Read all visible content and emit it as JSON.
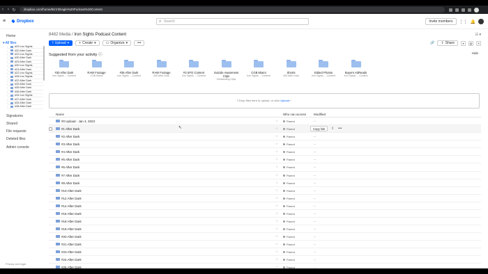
{
  "browser": {
    "url": "dropbox.com/home/Brrrrt/Eagle%20Podcast%20Content"
  },
  "app": {
    "brand": "Dropbox",
    "search_placeholder": "Search",
    "invite_label": "Invite members"
  },
  "sidebar": {
    "home": "Home",
    "all_files": "All files",
    "tree": [
      "#29 Iron Sights",
      "#32 After Dark",
      "#31 Iron Sights",
      "#30 After Dark",
      "#29 After Dark",
      "#30 Iron Sights",
      "#24 After Dark",
      "#22 Iron Sights",
      "#28 Iron Sights",
      "#22 After Dark",
      "#33 After Dark",
      "#35 After Dark",
      "#36 After Dark",
      "#34 Iron Sights",
      "#37 After Dark",
      "#34 After Dark",
      "#38 After Dark"
    ],
    "items": [
      "Signatures",
      "Shared",
      "File requests",
      "Deleted files",
      "Admin console"
    ],
    "footer": "Privacy and legal"
  },
  "breadcrumb": {
    "root": "8482 Media",
    "sep": "/",
    "current": "Iron Sights Podcast Content"
  },
  "toolbar": {
    "upload": "Upload",
    "create": "Create",
    "organize": "Organize",
    "more": "•••",
    "share": "Share"
  },
  "suggested": {
    "title": "Suggested from your activity",
    "hide": "Hide",
    "items": [
      {
        "name": "#30 After Dark",
        "sub": "Iron Sights ... Content"
      },
      {
        "name": "RAW Footage",
        "sub": "CGB Miami"
      },
      {
        "name": "#35 After Dark",
        "sub": "Iron Sights ... Content"
      },
      {
        "name": "RAW Footage",
        "sub": "#35 After Dark"
      },
      {
        "name": "#3 SFO Content",
        "sub": "Iron Sights ... Content"
      },
      {
        "name": "Suicide Awareness Clips",
        "sub": "Outstanding Clips"
      },
      {
        "name": "CGB Miami",
        "sub": "Iron Sights ... Content"
      },
      {
        "name": "Shorts",
        "sub": "#30 After Dark"
      },
      {
        "name": "Edited Photos",
        "sub": "Iron Sights ... Content"
      },
      {
        "name": "Buyers AdReads",
        "sub": "Iron Sights ... Content"
      }
    ]
  },
  "dropzone": {
    "text": "Drop files here to upload, or click",
    "link": "Upload"
  },
  "table": {
    "headers": {
      "name": "Name",
      "access": "Who can access",
      "modified": "Modified"
    },
    "copy_link": "Copy link",
    "rows": [
      {
        "name": "#0 Upload - Jan 4, 2023",
        "access": "Parent",
        "modified": "--"
      },
      {
        "name": "#1 After Dark",
        "access": "Parent",
        "modified": "--"
      },
      {
        "name": "#2 After Dark",
        "access": "Parent",
        "modified": "--"
      },
      {
        "name": "#3 After Dark",
        "access": "Parent",
        "modified": "--"
      },
      {
        "name": "#4 After Dark",
        "access": "Parent",
        "modified": "--"
      },
      {
        "name": "#5 After Dark",
        "access": "Parent",
        "modified": "--"
      },
      {
        "name": "#6 After Dark",
        "access": "Parent",
        "modified": "--"
      },
      {
        "name": "#7 After Dark",
        "access": "Parent",
        "modified": "--"
      },
      {
        "name": "#8 After Dark",
        "access": "Parent",
        "modified": "--"
      },
      {
        "name": "#10 After Dark",
        "access": "Parent",
        "modified": "--"
      },
      {
        "name": "#12 After Dark",
        "access": "Parent",
        "modified": "--"
      },
      {
        "name": "#14 After Dark",
        "access": "Parent",
        "modified": "--"
      },
      {
        "name": "#16 After Dark",
        "access": "Parent",
        "modified": "--"
      },
      {
        "name": "#18 After Dark",
        "access": "Parent",
        "modified": "--"
      },
      {
        "name": "#19 After Dark",
        "access": "Parent",
        "modified": "--"
      },
      {
        "name": "#20 After Dark",
        "access": "Parent",
        "modified": "--"
      },
      {
        "name": "#21 After Dark",
        "access": "Parent",
        "modified": "--"
      },
      {
        "name": "#23 After Dark",
        "access": "Parent",
        "modified": "--"
      },
      {
        "name": "#24 After Dark",
        "access": "Parent",
        "modified": "--"
      },
      {
        "name": "#25 After Dark",
        "access": "Parent",
        "modified": "--"
      }
    ]
  },
  "colors": {
    "accent": "#0061fe",
    "folder": "#7ba0d8"
  }
}
